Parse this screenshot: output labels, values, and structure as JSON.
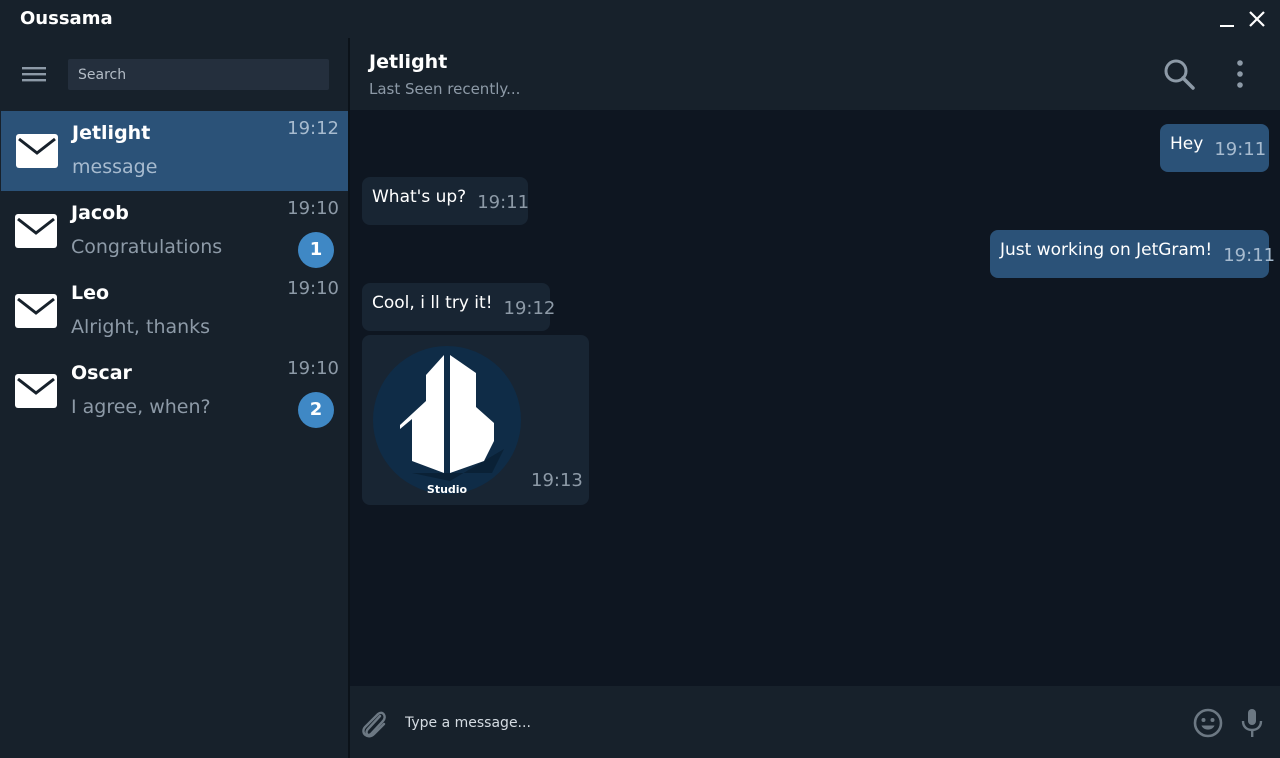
{
  "window": {
    "title": "Oussama"
  },
  "sidebar": {
    "search_placeholder": "Search",
    "chats": [
      {
        "name": "Jetlight",
        "preview": "message",
        "time": "19:12",
        "unread": "",
        "active": true
      },
      {
        "name": "Jacob",
        "preview": "Congratulations",
        "time": "19:10",
        "unread": "1",
        "active": false
      },
      {
        "name": "Leo",
        "preview": "Alright, thanks",
        "time": "19:10",
        "unread": "",
        "active": false
      },
      {
        "name": "Oscar",
        "preview": "I agree, when?",
        "time": "19:10",
        "unread": "2",
        "active": false
      }
    ]
  },
  "header": {
    "name": "Jetlight",
    "status": "Last Seen recently..."
  },
  "messages": [
    {
      "direction": "out",
      "text": "Hey",
      "time": "19:11"
    },
    {
      "direction": "in",
      "text": "What's up?",
      "time": "19:11"
    },
    {
      "direction": "out",
      "text": "Just working on JetGram!",
      "time": "19:11"
    },
    {
      "direction": "in",
      "text": "Cool, i ll try it!",
      "time": "19:12"
    },
    {
      "direction": "in",
      "type": "image",
      "caption_logo": "Studio",
      "time": "19:13"
    }
  ],
  "composer": {
    "placeholder": "Type a message..."
  },
  "icons": {
    "minimize": "minimize-icon",
    "close": "close-icon",
    "menu": "hamburger-menu-icon",
    "avatar": "envelope-icon",
    "search": "search-icon",
    "more": "more-vertical-icon",
    "attach": "paperclip-icon",
    "emoji": "smiley-icon",
    "mic": "microphone-icon"
  },
  "colors": {
    "accent": "#2b5278",
    "badge": "#3f88c5",
    "panel": "#17212b",
    "background": "#0e1621",
    "incoming_bubble": "#182533"
  }
}
